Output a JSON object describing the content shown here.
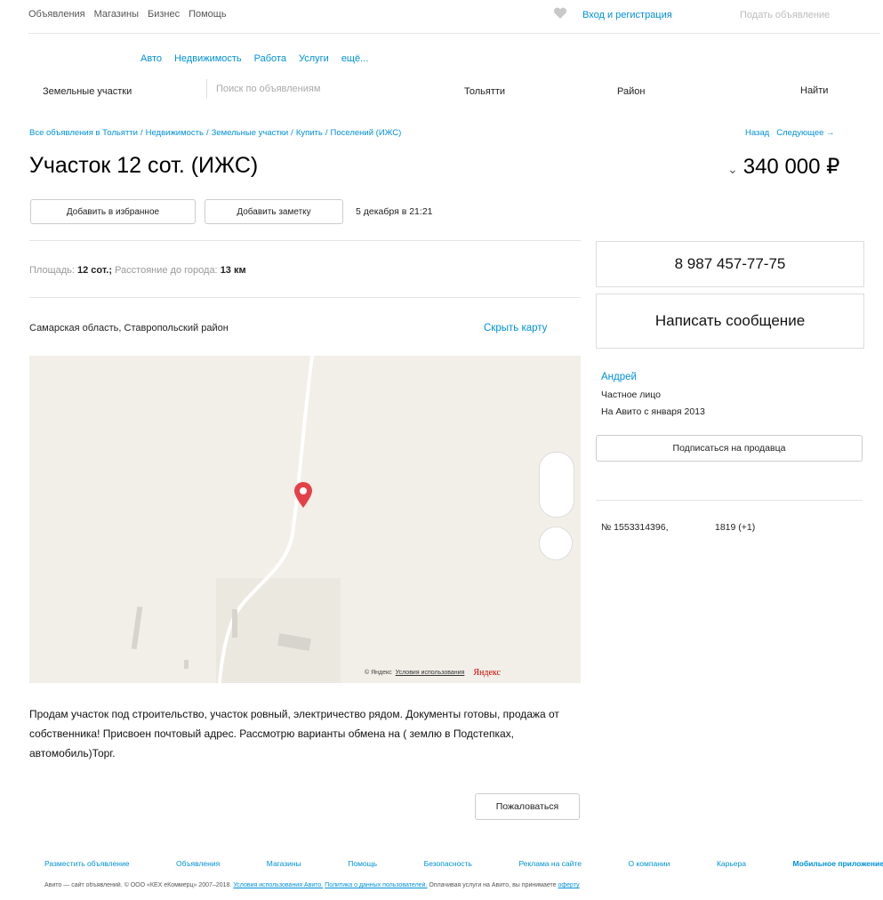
{
  "top_nav": {
    "links": [
      "Объявления",
      "Магазины",
      "Бизнес",
      "Помощь"
    ],
    "login": "Вход и регистрация",
    "post_ad": "Подать объявление",
    "heart_icon": "heart-icon"
  },
  "categories": [
    "Авто",
    "Недвижимость",
    "Работа",
    "Услуги",
    "ещё..."
  ],
  "search": {
    "category": "Земельные участки",
    "placeholder": "Поиск по объявлениям",
    "city": "Тольятти",
    "region": "Район",
    "button": "Найти"
  },
  "breadcrumb": [
    "Все объявления в Тольятти",
    "Недвижимость",
    "Земельные участки",
    "Купить",
    "Поселений (ИЖС)"
  ],
  "pager": {
    "prev": "Назад",
    "next": "Следующее →"
  },
  "listing": {
    "title": "Участок 12 сот. (ИЖС)",
    "price": "340 000 ₽",
    "add_favorite": "Добавить в избранное",
    "add_note": "Добавить заметку",
    "date": "5 декабря в 21:21",
    "params": {
      "area_label": "Площадь:",
      "area_value": "12 сот.;",
      "distance_label": "Расстояние до города:",
      "distance_value": "13 км"
    },
    "address": "Самарская область, Ставропольский район",
    "hide_map": "Скрыть карту",
    "description": "Продам участок под строительство, участок ровный, электричество рядом. Документы готовы, продажа от собственника! Присвоен почтовый адрес. Рассмотрю варианты обмена на ( землю в Подстепках, автомобиль)Торг.",
    "report": "Пожаловаться"
  },
  "map": {
    "attribution": "© Яндекс",
    "terms": "Условия использования",
    "logo": "Яндекс",
    "pin_icon": "map-pin-icon"
  },
  "seller": {
    "phone": "8 987 457-77-75",
    "write": "Написать сообщение",
    "name": "Андрей",
    "type": "Частное лицо",
    "since": "На Авито с января 2013",
    "subscribe": "Подписаться на продавца",
    "ad_number": "№ 1553314396,",
    "views": "1819 (+1)"
  },
  "footer": {
    "links": [
      "Разместить объявление",
      "Объявления",
      "Магазины",
      "Помощь",
      "Безопасность",
      "Реклама на сайте",
      "О компании",
      "Карьера",
      "Мобильное приложение"
    ],
    "legal_text": "Авито — сайт объявлений. © ООО «КЕХ еКоммерц» 2007–2018.",
    "legal_terms": "Условия использования Авито.",
    "legal_policy": "Политика о данных пользователей.",
    "legal_tail": "Оплачивая услуги на Авито, вы принимаете",
    "legal_offer": "оферту"
  },
  "colors": {
    "link": "#0091d9",
    "pin": "#e5404a",
    "map_bg": "#f1efe8"
  }
}
